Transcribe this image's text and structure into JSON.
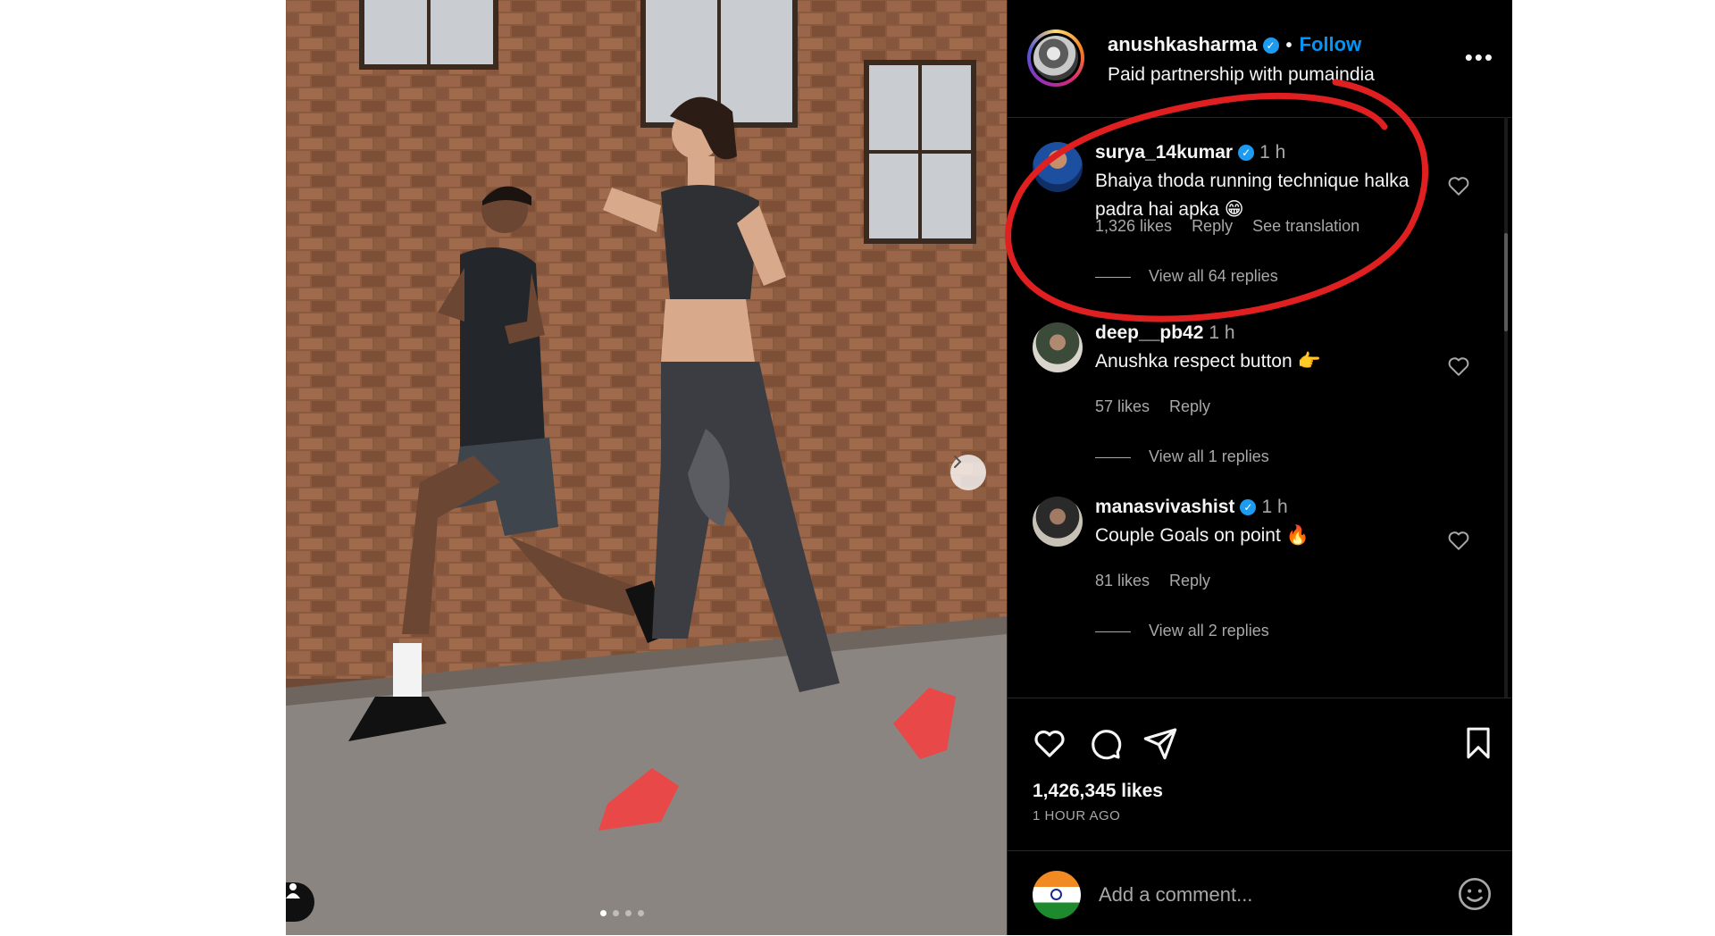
{
  "post": {
    "author": "anushkasharma",
    "follow_label": "Follow",
    "subtitle": "Paid partnership with pumaindia",
    "more_label": "•••",
    "likes": "1,426,345 likes",
    "time_ago": "1 HOUR AGO",
    "carousel": {
      "slides": 4,
      "active_index": 0
    }
  },
  "comments": [
    {
      "user": "surya_14kumar",
      "verified": true,
      "time": "1 h",
      "text": "Bhaiya thoda running technique halka padra hai apka 😁",
      "likes": "1,326 likes",
      "reply_label": "Reply",
      "translate_label": "See translation",
      "view_replies": "View all 64 replies"
    },
    {
      "user": "deep__pb42",
      "verified": false,
      "time": "1 h",
      "text": "Anushka respect button 👉",
      "likes": "57 likes",
      "reply_label": "Reply",
      "view_replies": "View all 1 replies"
    },
    {
      "user": "manasvivashist",
      "verified": true,
      "time": "1 h",
      "text": "Couple Goals on point 🔥",
      "likes": "81 likes",
      "reply_label": "Reply",
      "view_replies": "View all 2 replies"
    }
  ],
  "composer": {
    "placeholder": "Add a comment..."
  },
  "icons": {
    "like": "heart-icon",
    "comment": "comment-icon",
    "share": "send-icon",
    "save": "bookmark-icon",
    "emoji": "emoji-icon",
    "next": "chevron-right-icon",
    "tag": "user-tag-icon"
  },
  "colors": {
    "accent": "#0095f6",
    "verified": "#1d9bf0",
    "annotation": "#e02020",
    "panel_bg": "#000000"
  }
}
